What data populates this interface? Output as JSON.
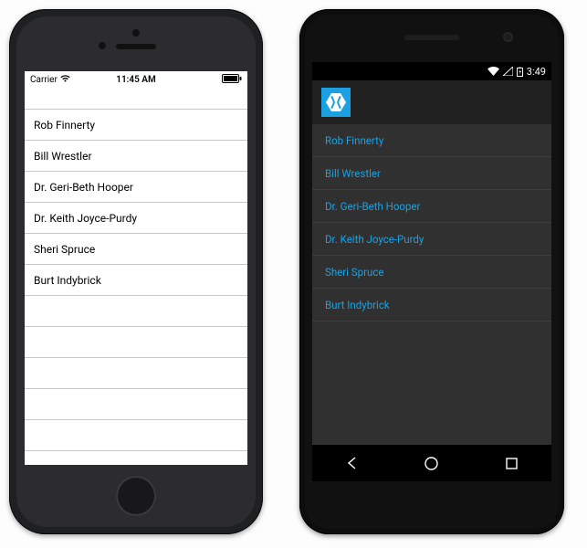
{
  "ios": {
    "status": {
      "carrier": "Carrier",
      "time": "11:45 AM"
    },
    "list": [
      "Rob Finnerty",
      "Bill Wrestler",
      "Dr. Geri-Beth Hooper",
      "Dr. Keith Joyce-Purdy",
      "Sheri Spruce",
      "Burt Indybrick"
    ]
  },
  "android": {
    "status": {
      "time": "3:49"
    },
    "accent": "#1ba1e2",
    "list": [
      "Rob Finnerty",
      "Bill Wrestler",
      "Dr. Geri-Beth Hooper",
      "Dr. Keith Joyce-Purdy",
      "Sheri Spruce",
      "Burt Indybrick"
    ]
  }
}
